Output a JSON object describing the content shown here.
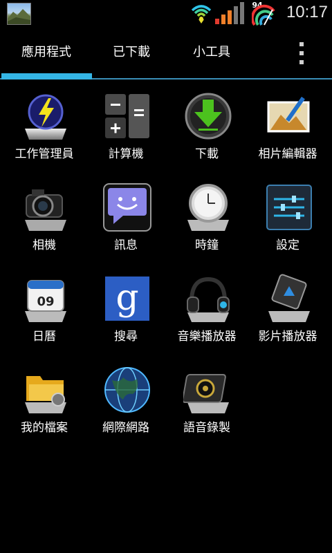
{
  "status_bar": {
    "battery_level": "94",
    "time": "10:17",
    "icons": [
      "notification-photo-icon",
      "wifi-icon",
      "signal-icon",
      "battery-icon"
    ]
  },
  "tabs": [
    {
      "label": "應用程式",
      "selected": true
    },
    {
      "label": "已下載",
      "selected": false
    },
    {
      "label": "小工具",
      "selected": false
    }
  ],
  "overflow_icon": "overflow-menu-icon",
  "colors": {
    "accent": "#34b5e5",
    "background": "#000000"
  },
  "apps": [
    {
      "label": "工作管理員",
      "icon": "task-manager-icon"
    },
    {
      "label": "計算機",
      "icon": "calculator-icon"
    },
    {
      "label": "下載",
      "icon": "download-icon"
    },
    {
      "label": "相片編輯器",
      "icon": "photo-editor-icon"
    },
    {
      "label": "相機",
      "icon": "camera-icon"
    },
    {
      "label": "訊息",
      "icon": "messaging-icon"
    },
    {
      "label": "時鐘",
      "icon": "clock-icon"
    },
    {
      "label": "設定",
      "icon": "settings-icon"
    },
    {
      "label": "日曆",
      "icon": "calendar-icon",
      "day": "09"
    },
    {
      "label": "搜尋",
      "icon": "google-search-icon",
      "glyph": "g"
    },
    {
      "label": "音樂播放器",
      "icon": "music-player-icon"
    },
    {
      "label": "影片播放器",
      "icon": "video-player-icon"
    },
    {
      "label": "我的檔案",
      "icon": "my-files-icon"
    },
    {
      "label": "網際網路",
      "icon": "browser-globe-icon"
    },
    {
      "label": "語音錄製",
      "icon": "voice-recorder-icon"
    }
  ]
}
